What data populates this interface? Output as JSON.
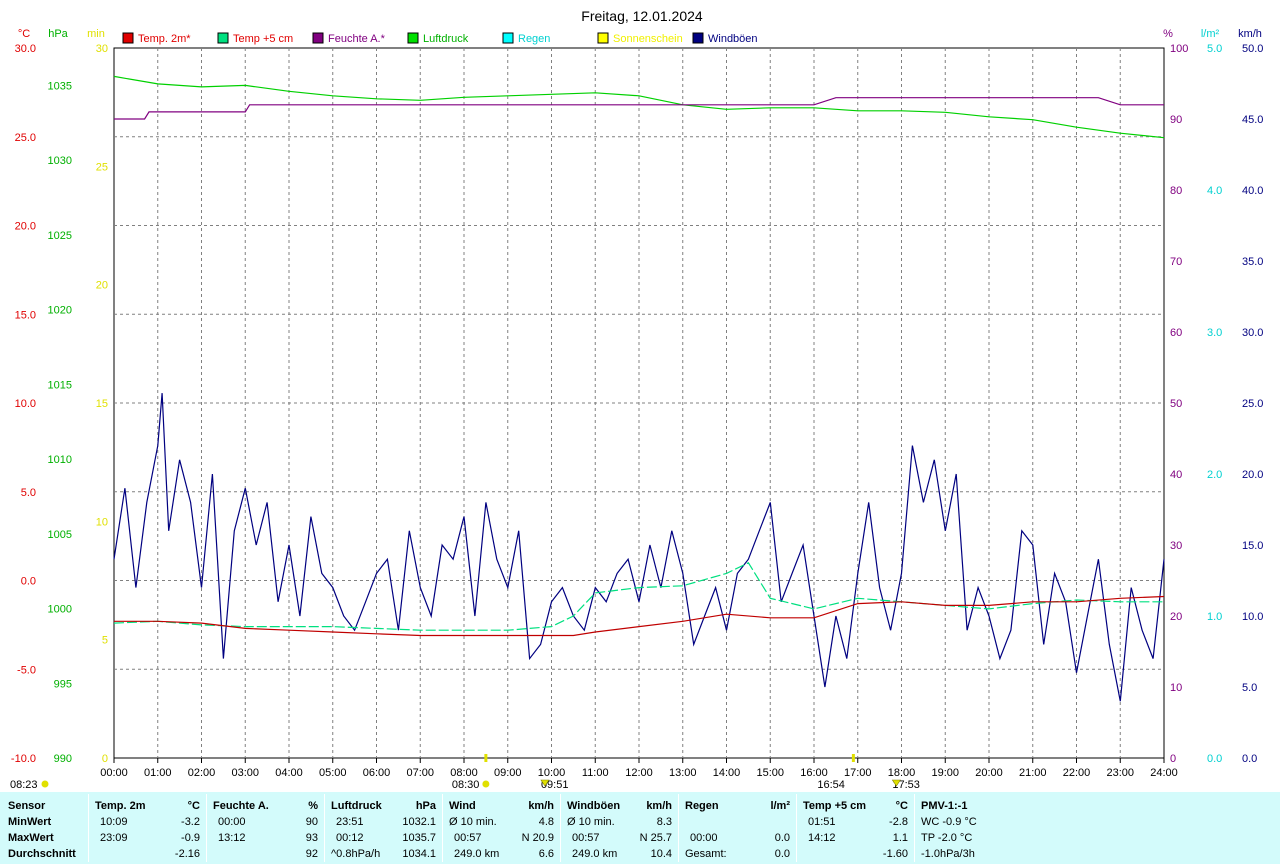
{
  "title": "Freitag, 12.01.2024",
  "units": {
    "left1": "°C",
    "left2": "hPa",
    "left3": "min",
    "right1": "%",
    "right2": "l/m²",
    "right3": "km/h"
  },
  "legend": [
    {
      "label": "Temp. 2m*",
      "color": "#e00000",
      "text_color": "#e00000"
    },
    {
      "label": "Temp +5 cm",
      "color": "#00e080",
      "text_color": "#e00000"
    },
    {
      "label": "Feuchte A.*",
      "color": "#800080",
      "text_color": "#800080"
    },
    {
      "label": "Luftdruck",
      "color": "#00e000",
      "text_color": "#00b000"
    },
    {
      "label": "Regen",
      "color": "#00ffff",
      "text_color": "#00d0d0"
    },
    {
      "label": "Sonnenschein",
      "color": "#ffff00",
      "text_color": "#f0f000"
    },
    {
      "label": "Windböen",
      "color": "#000080",
      "text_color": "#000080"
    }
  ],
  "axes": {
    "temp": [
      "30.0",
      "25.0",
      "20.0",
      "15.0",
      "10.0",
      "5.0",
      "0.0",
      "-5.0",
      "-10.0"
    ],
    "pressure": [
      "1035",
      "1030",
      "1025",
      "1020",
      "1015",
      "1010",
      "1005",
      "1000",
      "995",
      "990"
    ],
    "sun": [
      "30",
      "25",
      "20",
      "15",
      "10",
      "5",
      "0"
    ],
    "humidity": [
      "100",
      "90",
      "80",
      "70",
      "60",
      "50",
      "40",
      "30",
      "20",
      "10",
      "0"
    ],
    "rain": [
      "5.0",
      "4.0",
      "3.0",
      "2.0",
      "1.0",
      "0.0"
    ],
    "wind": [
      "50.0",
      "45.0",
      "40.0",
      "35.0",
      "30.0",
      "25.0",
      "20.0",
      "15.0",
      "10.0",
      "5.0",
      "0.0"
    ],
    "hours": [
      "00:00",
      "01:00",
      "02:00",
      "03:00",
      "04:00",
      "05:00",
      "06:00",
      "07:00",
      "08:00",
      "09:00",
      "10:00",
      "11:00",
      "12:00",
      "13:00",
      "14:00",
      "15:00",
      "16:00",
      "17:00",
      "18:00",
      "19:00",
      "20:00",
      "21:00",
      "22:00",
      "23:00",
      "24:00"
    ]
  },
  "sun_markers": [
    {
      "time": "08:23",
      "label": "08:23",
      "kind": "sunrise"
    },
    {
      "time": "08:30",
      "label": "08:30",
      "kind": "marker"
    },
    {
      "time": "09:51",
      "label": "09:51",
      "kind": "max"
    },
    {
      "time": "16:54",
      "label": "16:54",
      "kind": "marker"
    },
    {
      "time": "17:53",
      "label": "17:53",
      "kind": "sunset"
    }
  ],
  "chart_data": {
    "type": "line",
    "title": "Freitag, 12.01.2024",
    "x_range": [
      "00:00",
      "24:00"
    ],
    "y_ranges": {
      "temp_c": [
        -10,
        30
      ],
      "pressure_hpa": [
        990,
        1037.5
      ],
      "humidity_pct": [
        0,
        100
      ],
      "rain_lm2": [
        0,
        5
      ],
      "wind_kmh": [
        0,
        50
      ]
    },
    "series": [
      {
        "name": "Temp. 2m*",
        "axis": "temp_c",
        "color": "#c00000",
        "x": [
          0,
          1,
          2,
          3,
          4,
          5,
          6,
          7,
          8,
          9,
          10,
          10.5,
          11,
          12,
          13,
          14,
          15,
          16,
          17,
          18,
          19,
          20,
          21,
          22,
          23,
          24
        ],
        "y": [
          -2.3,
          -2.3,
          -2.4,
          -2.7,
          -2.8,
          -2.9,
          -3.0,
          -3.1,
          -3.1,
          -3.1,
          -3.1,
          -3.1,
          -2.9,
          -2.6,
          -2.3,
          -1.9,
          -2.1,
          -2.1,
          -1.3,
          -1.2,
          -1.4,
          -1.4,
          -1.2,
          -1.2,
          -1.0,
          -0.9
        ]
      },
      {
        "name": "Temp +5 cm",
        "axis": "temp_c",
        "color": "#00e080",
        "x": [
          0,
          1,
          2,
          3,
          4,
          5,
          6,
          7,
          8,
          9,
          10,
          10.5,
          11,
          12,
          13,
          14,
          14.5,
          15,
          16,
          17,
          18,
          19,
          20,
          21,
          22,
          23,
          24
        ],
        "y": [
          -2.4,
          -2.3,
          -2.5,
          -2.6,
          -2.6,
          -2.6,
          -2.7,
          -2.8,
          -2.8,
          -2.8,
          -2.6,
          -2.0,
          -0.7,
          -0.4,
          -0.3,
          0.4,
          1.0,
          -1.0,
          -1.6,
          -1.0,
          -1.2,
          -1.4,
          -1.6,
          -1.3,
          -1.1,
          -1.2,
          -1.2
        ]
      },
      {
        "name": "Feuchte A.*",
        "axis": "humidity_pct",
        "color": "#800080",
        "x": [
          0,
          0.7,
          0.8,
          3,
          3.1,
          5,
          6,
          8,
          9,
          10,
          11,
          12,
          13,
          14,
          15,
          16,
          16.5,
          17,
          18,
          19,
          20,
          21,
          22,
          22.5,
          23,
          24
        ],
        "y": [
          90,
          90,
          91,
          91,
          92,
          92,
          92,
          92,
          92,
          92,
          92,
          92,
          92,
          92,
          92,
          92,
          93,
          93,
          93,
          93,
          93,
          93,
          93,
          93,
          92,
          92
        ]
      },
      {
        "name": "Luftdruck",
        "axis": "pressure_hpa",
        "color": "#00d000",
        "x": [
          0,
          1,
          2,
          3,
          4,
          5,
          6,
          7,
          8,
          9,
          10,
          11,
          12,
          13,
          14,
          15,
          16,
          17,
          18,
          19,
          20,
          21,
          22,
          23,
          24
        ],
        "y": [
          1035.6,
          1035.1,
          1034.9,
          1035.0,
          1034.6,
          1034.3,
          1034.1,
          1034.0,
          1034.2,
          1034.3,
          1034.4,
          1034.5,
          1034.3,
          1033.7,
          1033.4,
          1033.5,
          1033.5,
          1033.3,
          1033.3,
          1033.2,
          1032.9,
          1032.7,
          1032.2,
          1031.8,
          1031.5
        ]
      },
      {
        "name": "Windböen",
        "axis": "wind_kmh",
        "color": "#000080",
        "x": [
          0,
          0.25,
          0.5,
          0.75,
          1,
          1.1,
          1.25,
          1.5,
          1.75,
          2,
          2.25,
          2.5,
          2.75,
          3,
          3.25,
          3.5,
          3.75,
          4,
          4.25,
          4.5,
          4.75,
          5,
          5.25,
          5.5,
          5.75,
          6,
          6.25,
          6.5,
          6.75,
          7,
          7.25,
          7.5,
          7.75,
          8,
          8.25,
          8.5,
          8.75,
          9,
          9.25,
          9.5,
          9.75,
          10,
          10.25,
          10.5,
          10.75,
          11,
          11.25,
          11.5,
          11.75,
          12,
          12.25,
          12.5,
          12.75,
          13,
          13.25,
          13.5,
          13.75,
          14,
          14.25,
          14.5,
          14.75,
          15,
          15.25,
          15.5,
          15.75,
          16,
          16.25,
          16.5,
          16.75,
          17,
          17.25,
          17.5,
          17.75,
          18,
          18.25,
          18.5,
          18.75,
          19,
          19.25,
          19.5,
          19.75,
          20,
          20.25,
          20.5,
          20.75,
          21,
          21.25,
          21.5,
          21.75,
          22,
          22.25,
          22.5,
          22.75,
          23,
          23.25,
          23.5,
          23.75,
          24
        ],
        "y": [
          14,
          19,
          12,
          18,
          22,
          25.7,
          16,
          21,
          18,
          12,
          20,
          7,
          16,
          19,
          15,
          18,
          11,
          15,
          10,
          17,
          13,
          12,
          10,
          9,
          11,
          13,
          14,
          9,
          16,
          12,
          10,
          15,
          14,
          17,
          10,
          18,
          14,
          12,
          16,
          7,
          8,
          11,
          12,
          10,
          9,
          12,
          11,
          13,
          14,
          11,
          15,
          12,
          16,
          13,
          8,
          10,
          12,
          9,
          13,
          14,
          16,
          18,
          11,
          13,
          15,
          10,
          5,
          10,
          7,
          13,
          18,
          12,
          9,
          13,
          22,
          18,
          21,
          16,
          20,
          9,
          12,
          10,
          7,
          9,
          16,
          15,
          8,
          13,
          11,
          6,
          10,
          14,
          8,
          4,
          12,
          9,
          7,
          14
        ]
      }
    ]
  },
  "stats": {
    "col_sensor": {
      "header": "Sensor",
      "rows": [
        "MinWert",
        "MaxWert",
        "Durchschnitt"
      ]
    },
    "temp2m": {
      "header": "Temp. 2m",
      "unit": "°C",
      "rows": [
        {
          "t": "10:09",
          "v": "-3.2"
        },
        {
          "t": "23:09",
          "v": "-0.9"
        },
        {
          "t": "",
          "v": "-2.16"
        }
      ]
    },
    "feuchte": {
      "header": "Feuchte A.",
      "unit": "%",
      "rows": [
        {
          "t": "00:00",
          "v": "90"
        },
        {
          "t": "13:12",
          "v": "93"
        },
        {
          "t": "",
          "v": "92"
        }
      ]
    },
    "luftdruck": {
      "header": "Luftdruck",
      "unit": "hPa",
      "rows": [
        {
          "t": "23:51",
          "v": "1032.1"
        },
        {
          "t": "00:12",
          "v": "1035.7"
        },
        {
          "t": "^0.8hPa/h",
          "v": "1034.1"
        }
      ]
    },
    "wind": {
      "header": "Wind",
      "unit": "km/h",
      "rows": [
        {
          "t": "Ø 10 min.",
          "v": "4.8"
        },
        {
          "t": "00:57",
          "v": "N 20.9"
        },
        {
          "t": "249.0 km",
          "v": "6.6"
        }
      ]
    },
    "windboeen": {
      "header": "Windböen",
      "unit": "km/h",
      "rows": [
        {
          "t": "Ø 10 min.",
          "v": "8.3"
        },
        {
          "t": "00:57",
          "v": "N 25.7"
        },
        {
          "t": "249.0 km",
          "v": "10.4"
        }
      ]
    },
    "regen": {
      "header": "Regen",
      "unit": "l/m²",
      "rows": [
        {
          "t": "",
          "v": ""
        },
        {
          "t": "00:00",
          "v": "0.0"
        },
        {
          "t": "Gesamt:",
          "v": "0.0"
        }
      ]
    },
    "temp5cm": {
      "header": "Temp +5 cm",
      "unit": "°C",
      "rows": [
        {
          "t": "01:51",
          "v": "-2.8"
        },
        {
          "t": "14:12",
          "v": "1.1"
        },
        {
          "t": "",
          "v": "-1.60"
        }
      ]
    },
    "pmv": {
      "header": "PMV-1:-1",
      "rows": [
        "WC -0.9 °C",
        "TP -2.0 °C",
        "-1.0hPa/3h"
      ]
    }
  }
}
